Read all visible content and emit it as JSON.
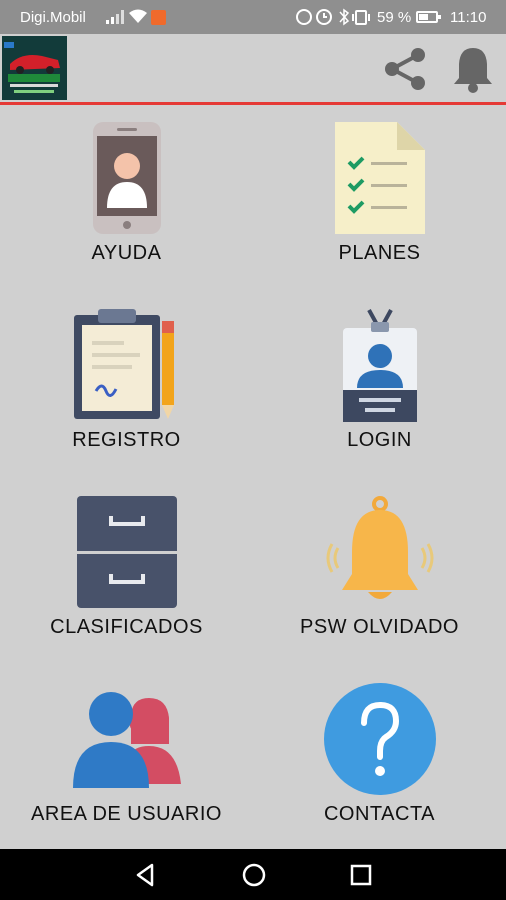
{
  "status_bar": {
    "carrier": "Digi.Mobil",
    "battery_percent": "59 %",
    "time": "11:10"
  },
  "app_bar": {
    "logo_text": "LA RUTA",
    "accent_color": "#e53935"
  },
  "menu": [
    {
      "label": "AYUDA",
      "icon": "phone-contact-icon"
    },
    {
      "label": "PLANES",
      "icon": "checklist-icon"
    },
    {
      "label": "REGISTRO",
      "icon": "clipboard-icon"
    },
    {
      "label": "LOGIN",
      "icon": "id-badge-icon"
    },
    {
      "label": "CLASIFICADOS",
      "icon": "file-cabinet-icon"
    },
    {
      "label": "PSW OLVIDADO",
      "icon": "bell-ringing-icon"
    },
    {
      "label": "AREA DE USUARIO",
      "icon": "users-icon"
    },
    {
      "label": "CONTACTA",
      "icon": "question-icon"
    }
  ]
}
